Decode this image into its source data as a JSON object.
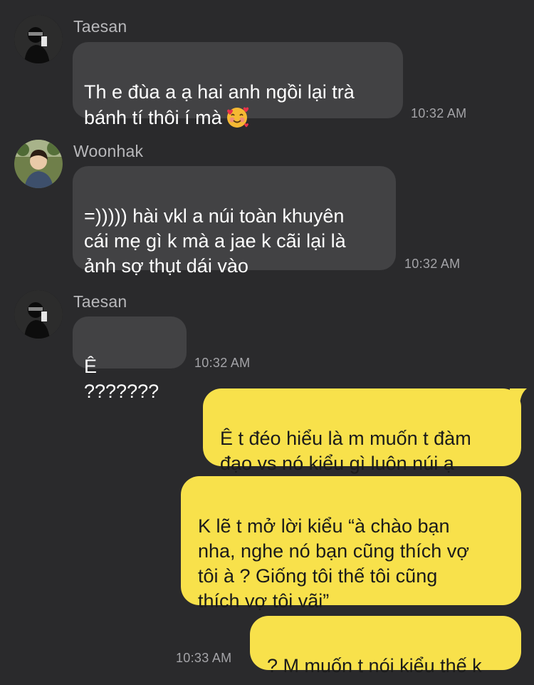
{
  "messages": [
    {
      "sender": "Taesan",
      "avatar_icon": "profile-photo-mirror-selfie",
      "text": "Th e đùa a ạ hai anh ngồi lại trà\nbánh tí thôi í mà",
      "emoji": "smiling-face-with-hearts",
      "time": "10:32 AM"
    },
    {
      "sender": "Woonhak",
      "avatar_icon": "profile-photo-outdoor",
      "text": "=))))) hài vkl a núi toàn khuyên\ncái mẹ gì k mà a jae k cãi lại là\nảnh sợ thụt dái vào",
      "time": "10:32 AM"
    },
    {
      "sender": "Taesan",
      "avatar_icon": "profile-photo-mirror-selfie",
      "text": "Ê ???????",
      "time": "10:32 AM"
    }
  ],
  "outgoing": [
    {
      "text": "Ê t đéo hiểu là m muốn t đàm\nđạo vs nó kiểu gì luôn núi ạ"
    },
    {
      "text": "K lẽ t mở lời kiểu “à chào bạn\nnha, nghe nó bạn cũng thích vợ\ntôi à ? Giống tôi thế tôi cũng\nthích vợ tôi vãi”"
    },
    {
      "text": "? M muốn t nói kiểu thế k",
      "time": "10:33 AM"
    }
  ],
  "colors": {
    "background": "#2a2a2c",
    "incoming_bubble": "#424244",
    "outgoing_bubble": "#f8e14b",
    "timestamp": "#a4a4a8",
    "sender_name": "#b8b8bb"
  }
}
